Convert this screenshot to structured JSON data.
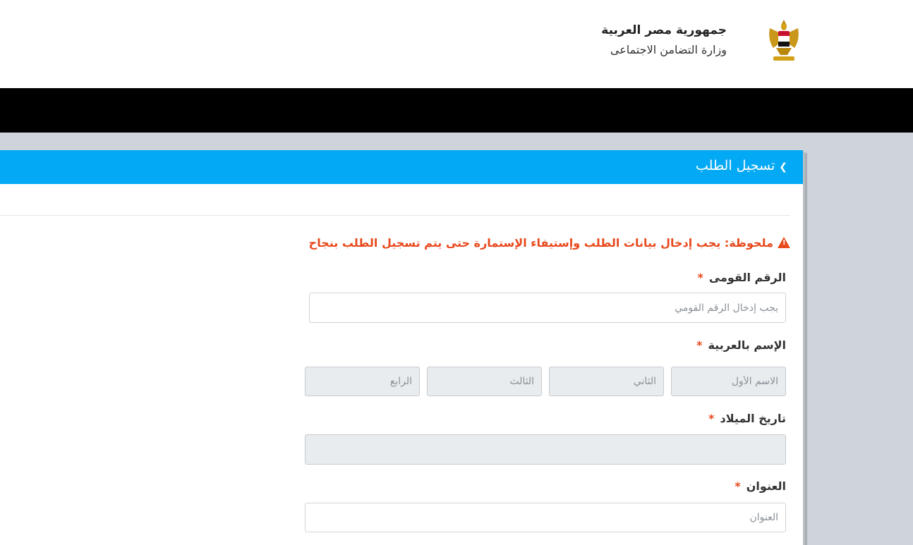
{
  "header": {
    "country": "جمهورية مصر العربية",
    "ministry": "وزارة التضامن الاجتماعى",
    "logo_icon": "egypt-eagle-emblem-icon"
  },
  "panel": {
    "title": "تسجيل الطلب",
    "toggle_icon": "chevron-down-icon"
  },
  "note": {
    "icon": "warning-triangle-icon",
    "text": "ملحوظة: يجب إدخال بيانات الطلب وإستيفاء الإستمارة حتى يتم تسجيل الطلب بنجاح"
  },
  "fields": {
    "national_id": {
      "label": "الرقم القومى",
      "required": "*",
      "placeholder": "يجب إدخال الرقم القومي",
      "value": ""
    },
    "arabic_name": {
      "label": "الإسم بالعربية",
      "required": "*",
      "first_placeholder": "الاسم الأول",
      "second_placeholder": "الثاني",
      "third_placeholder": "الثالث",
      "fourth_placeholder": "الرابع"
    },
    "birth_date": {
      "label": "تاريخ الميلاد",
      "required": "*",
      "value": ""
    },
    "address": {
      "label": "العنوان",
      "required": "*",
      "placeholder": "العنوان",
      "value": ""
    }
  },
  "colors": {
    "panel_header": "#03a9f4",
    "warning": "#e8491d",
    "navbar": "#000000"
  }
}
